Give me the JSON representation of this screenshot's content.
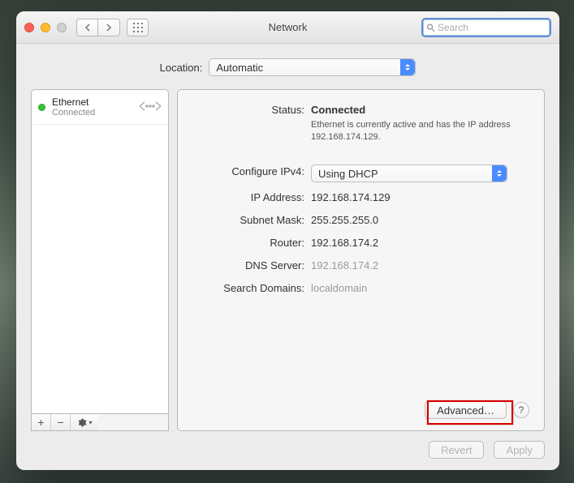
{
  "window": {
    "title": "Network"
  },
  "search": {
    "placeholder": "Search",
    "value": ""
  },
  "location": {
    "label": "Location:",
    "value": "Automatic"
  },
  "service": {
    "name": "Ethernet",
    "status_short": "Connected",
    "icon": "ethernet-icon",
    "dot_color": "#36c23b"
  },
  "status": {
    "label": "Status:",
    "value": "Connected",
    "description": "Ethernet is currently active and has the IP address 192.168.174.129."
  },
  "configure": {
    "label": "Configure IPv4:",
    "value": "Using DHCP"
  },
  "ip": {
    "label": "IP Address:",
    "value": "192.168.174.129"
  },
  "mask": {
    "label": "Subnet Mask:",
    "value": "255.255.255.0"
  },
  "router": {
    "label": "Router:",
    "value": "192.168.174.2"
  },
  "dns": {
    "label": "DNS Server:",
    "value": "192.168.174.2"
  },
  "search_domains": {
    "label": "Search Domains:",
    "value": "localdomain"
  },
  "buttons": {
    "advanced": "Advanced…",
    "revert": "Revert",
    "apply": "Apply",
    "help": "?"
  },
  "sidebar_actions": {
    "add": "+",
    "remove": "−",
    "gear": "⚙︎",
    "gear_chevron": "▾"
  }
}
